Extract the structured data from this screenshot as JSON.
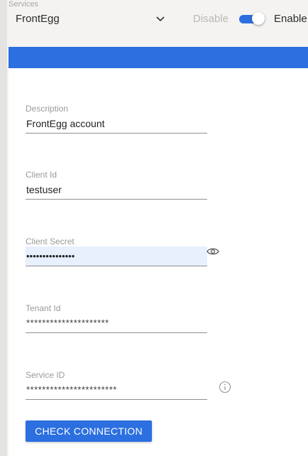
{
  "header": {
    "services_label": "Services",
    "selected_service": "FrontEgg",
    "disable_label": "Disable",
    "enable_label": "Enable",
    "enabled": true
  },
  "form": {
    "description": {
      "label": "Description",
      "value": "FrontEgg account"
    },
    "client_id": {
      "label": "Client Id",
      "value": "testuser"
    },
    "client_secret": {
      "label": "Client Secret",
      "value": "•••••••••••••••"
    },
    "tenant_id": {
      "label": "Tenant Id",
      "value": "*********************"
    },
    "service_id": {
      "label": "Service ID",
      "value": "***********************"
    }
  },
  "actions": {
    "check_connection_label": "CHECK CONNECTION"
  },
  "icons": {
    "dropdown": "chevron-down-icon",
    "reveal": "eye-icon",
    "info": "info-icon"
  },
  "colors": {
    "accent": "#2b6fe0",
    "autofill_bg": "#e8f0fe"
  }
}
